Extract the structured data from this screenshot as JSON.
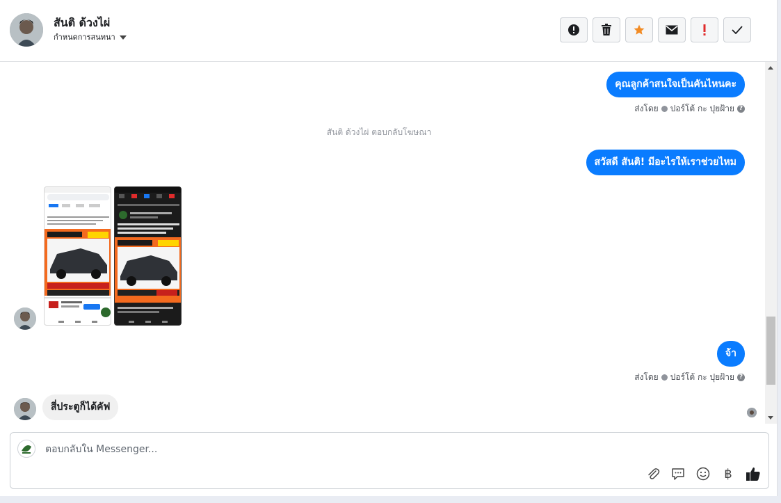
{
  "header": {
    "contact_name": "สันติ ด้วงไผ่",
    "assign_label": "กำหนดการสนทนา",
    "toolbar": [
      {
        "name": "report-icon",
        "color": "#1c1e21"
      },
      {
        "name": "trash-icon",
        "color": "#1c1e21"
      },
      {
        "name": "star-icon",
        "color": "#f28b24"
      },
      {
        "name": "envelope-icon",
        "color": "#1c1e21"
      },
      {
        "name": "exclamation-icon",
        "color": "#e02b2b"
      },
      {
        "name": "check-icon",
        "color": "#1c1e21"
      }
    ]
  },
  "messages": {
    "out_1": "คุณลูกค้าสนใจเป็นคันไหนคะ",
    "sent_by_1": {
      "prefix": "ส่งโดย",
      "agent": "ปอร์โต้ กะ ปุยฝ้าย"
    },
    "system_note": "สันติ ด้วงไผ่ ตอบกลับโฆษณา",
    "out_2": "สวัสดี สันติ! มีอะไรให้เราช่วยไหม",
    "out_3": "จ้า",
    "sent_by_3": {
      "prefix": "ส่งโดย",
      "agent": "ปอร์โต้ กะ ปุยฝ้าย"
    },
    "in_1": "สี่ประตูก็ได้คัฟ"
  },
  "composer": {
    "placeholder": "ตอบกลับใน Messenger...",
    "tools": [
      "paperclip-icon",
      "speech-bubble-icon",
      "smiley-icon",
      "baht-icon",
      "thumbs-up-icon"
    ],
    "baht_symbol": "฿"
  },
  "colors": {
    "accent_blue": "#0a7cff",
    "incoming_bubble": "#f0f0f0"
  }
}
